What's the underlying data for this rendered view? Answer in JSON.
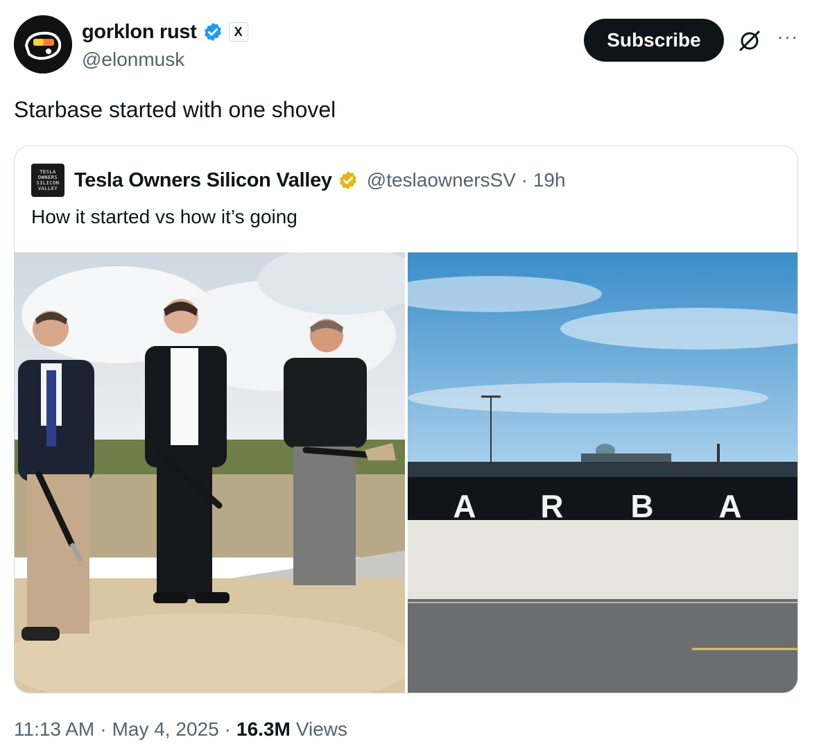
{
  "author": {
    "display_name": "gorklon rust",
    "handle": "@elonmusk",
    "avatar_icon": "avatar-graphic",
    "verified_color": "#1d9bf0",
    "affiliate_badge": "X"
  },
  "actions": {
    "subscribe_label": "Subscribe",
    "grok_icon": "grok-icon",
    "more_label": "···"
  },
  "tweet": {
    "text": "Starbase started with one shovel"
  },
  "quoted": {
    "avatar_lines": [
      "TESLA",
      "OWNERS",
      "SILICON",
      "VALLEY"
    ],
    "display_name": "Tesla Owners Silicon Valley",
    "verified_color": "#e2b719",
    "handle_time": "@teslaownersSV · 19h",
    "text": "How it started vs how it’s going",
    "photo_right_letters": [
      "A",
      "R",
      "B",
      "A"
    ]
  },
  "footer": {
    "time": "11:13 AM",
    "sep1": "·",
    "date": "May 4, 2025",
    "sep2": "·",
    "views_count": "16.3M",
    "views_label": "Views"
  },
  "colors": {
    "text_primary": "#0f1419",
    "text_secondary": "#536471",
    "border": "#cfd9de"
  }
}
